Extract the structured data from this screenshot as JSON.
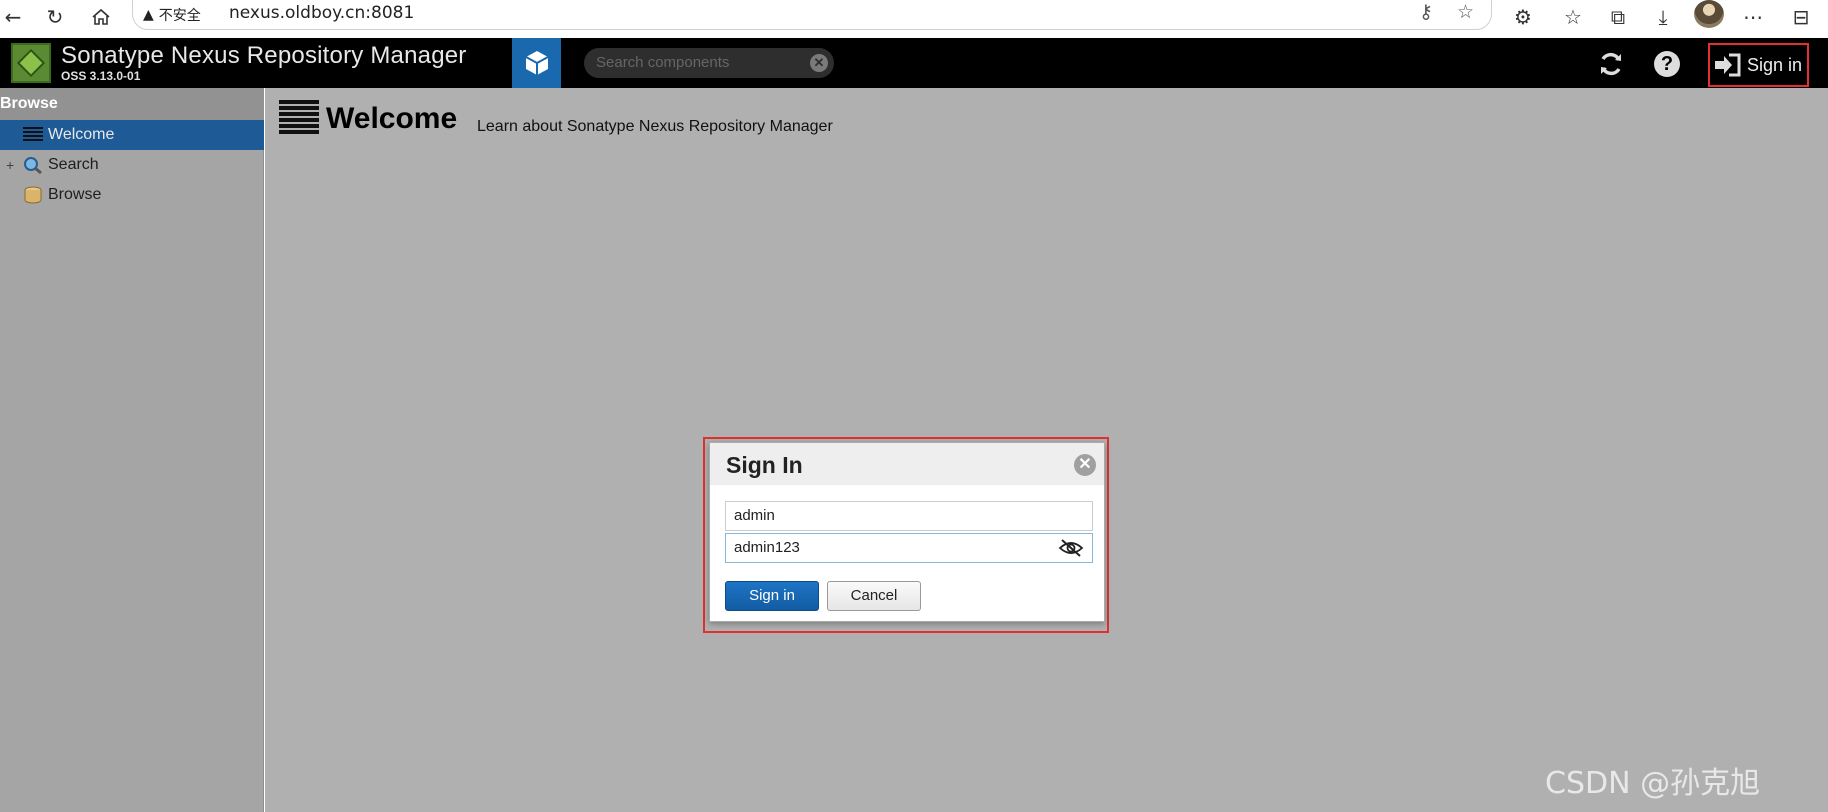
{
  "browser": {
    "security_label": "不安全",
    "url": "nexus.oldboy.cn:8081"
  },
  "header": {
    "title": "Sonatype Nexus Repository Manager",
    "version": "OSS 3.13.0-01",
    "search_placeholder": "Search components",
    "signin_label": "Sign in"
  },
  "sidebar": {
    "heading": "Browse",
    "items": [
      {
        "label": "Welcome",
        "active": true,
        "icon": "welcome-icon"
      },
      {
        "label": "Search",
        "active": false,
        "icon": "search-icon"
      },
      {
        "label": "Browse",
        "active": false,
        "icon": "database-icon"
      }
    ]
  },
  "main": {
    "title": "Welcome",
    "subtitle": "Learn about Sonatype Nexus Repository Manager"
  },
  "dialog": {
    "title": "Sign In",
    "username_value": "admin",
    "password_value": "admin123",
    "submit_label": "Sign in",
    "cancel_label": "Cancel"
  },
  "watermark": "CSDN @孙克旭",
  "colors": {
    "accent": "#1e5a96",
    "highlight_border": "#e03030",
    "header_bg": "#000000"
  }
}
